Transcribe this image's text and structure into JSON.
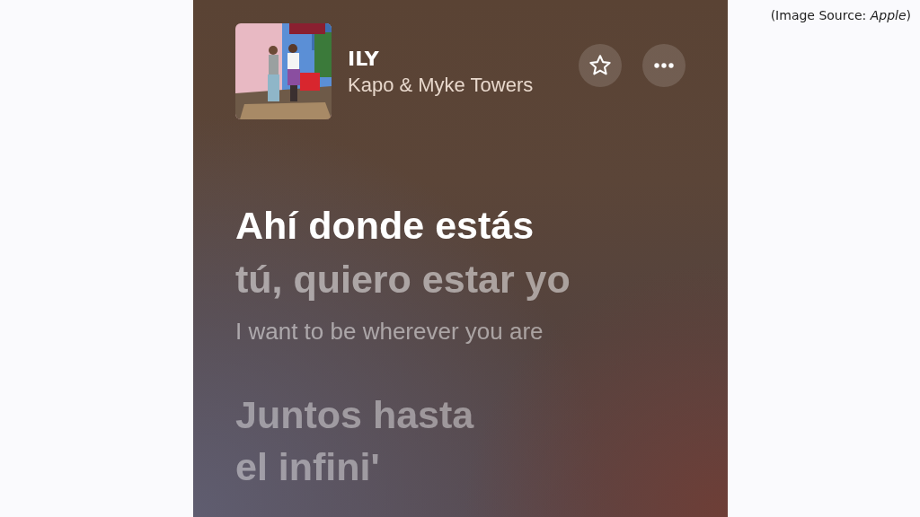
{
  "caption": "(Image Source: *Apple*)",
  "player": {
    "title": "ILY",
    "artist": "Kapo & Myke Towers",
    "favorite": false
  },
  "lyrics": [
    {
      "kind": "current",
      "text": "Ahí donde estás"
    },
    {
      "kind": "upcoming",
      "text": "tú, quiero estar yo"
    },
    {
      "kind": "translation",
      "text": "I want to be wherever you are"
    },
    {
      "kind": "blurred",
      "text": "Juntos hasta"
    },
    {
      "kind": "blurred",
      "text": "el infini'"
    }
  ]
}
